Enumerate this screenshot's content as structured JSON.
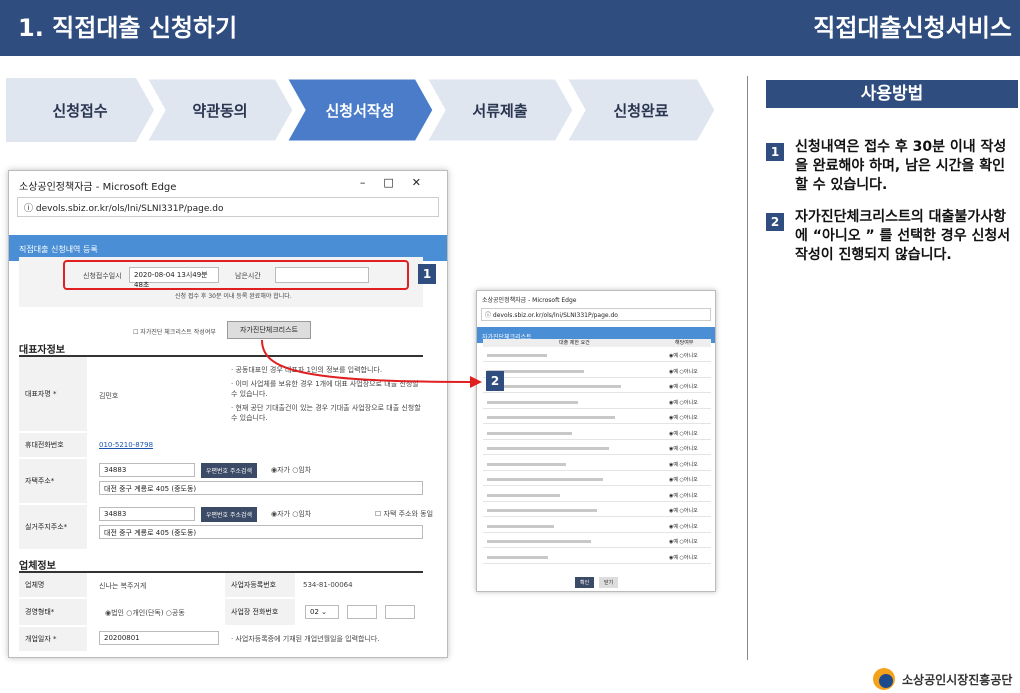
{
  "header": {
    "title": "1. 직접대출 신청하기",
    "service": "직접대출신청서비스"
  },
  "steps": [
    {
      "label": "신청접수"
    },
    {
      "label": "약관동의"
    },
    {
      "label": "신청서작성"
    },
    {
      "label": "서류제출"
    },
    {
      "label": "신청완료"
    }
  ],
  "howto": {
    "title": "사용방법",
    "tips": [
      {
        "num": "1",
        "text": "신청내역은 접수 후 30분 이내 작성을 완료해야 하며, 남은 시간을 확인할 수 있습니다."
      },
      {
        "num": "2",
        "text": "자가진단체크리스트의 대출불가사항에 “아니오 ” 를 선택한 경우 신청서 작성이 진행되지 않습니다."
      }
    ]
  },
  "main_window": {
    "title": "소상공인정책자금 - Microsoft Edge",
    "url": "devols.sbiz.or.kr/ols/lni/SLNI331P/page.do",
    "banner": "직접대출 신청내역 등록",
    "apply_time_label": "신청접수일시",
    "apply_time_value": "2020-08-04 13시49분48초",
    "remain_label": "남은시간",
    "notice": "신청 접수 후 30분 이내 등록 완료해야 합니다.",
    "checklist_label": "자가진단 체크리스트 작성여부",
    "checklist_button": "자가진단체크리스트",
    "rep_section": "대표자정보",
    "rep_name_label": "대표자명 *",
    "rep_name": "김민호",
    "rep_notes": [
      "· 공동대표인 경우 대표자 1인의 정보를 입력합니다.",
      "· 이미 사업체를 보유한 경우 1개에 대표 사업장으로 대출 신청할 수 있습니다.",
      "· 현재 공단 기대출건이 있는 경우 기대출 사업장으로 대출 신청할 수 있습니다."
    ],
    "phone_label": "휴대전화번호",
    "phone": "010-5210-8798",
    "home_label": "자택주소*",
    "home_zip": "34883",
    "home_addr": "대전 중구 계룡로 405 (중도동)",
    "biz_label": "실거주지주소*",
    "biz_zip": "34883",
    "biz_addr": "대전 중구 계룡로 405 (중도동)",
    "zip_button": "우편번호 주소검색",
    "own": "자가",
    "rent": "임차",
    "same_home": "자택 주소와 동일",
    "company_section": "업체정보",
    "company_name_label": "업체명",
    "company_name": "신나는 복주거게",
    "reg_label": "사업자등록번호",
    "reg_no": "534-81-00064",
    "type_label": "경영형태*",
    "type_corp": "법인",
    "type_sole": "개인(단독)",
    "type_joint": "공동",
    "tel_label": "사업장 전화번호",
    "tel_area": "02",
    "open_label": "개업일자 *",
    "open_date": "20200801",
    "open_note": "· 사업자등록증에 기재된 개업년월일을 입력합니다."
  },
  "popup": {
    "title": "소상공인정책자금 - Microsoft Edge",
    "url": "devols.sbiz.or.kr/ols/lni/SLNI331P/page.do",
    "banner": "자가진단체크리스트",
    "col_item": "대출 제한 요건",
    "col_ans": "해당여부",
    "yes": "예",
    "no": "아니오",
    "rows": 14,
    "confirm": "확인",
    "close": "닫기"
  },
  "badges": {
    "one": "1",
    "two": "2"
  },
  "logo": {
    "text": "소상공인시장진흥공단"
  }
}
